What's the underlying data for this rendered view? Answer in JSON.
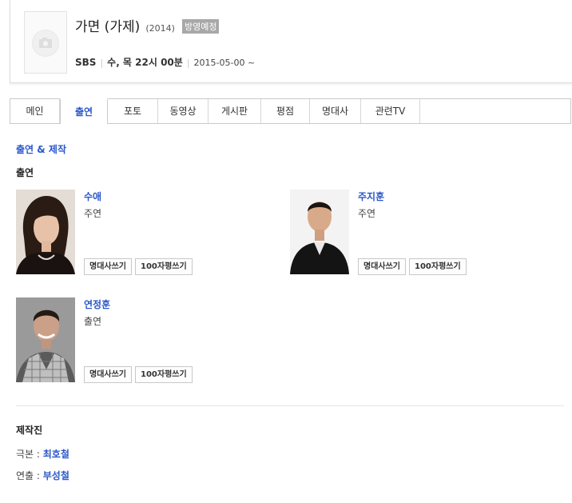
{
  "header": {
    "title": "가면 (가제)",
    "year": "(2014)",
    "badge": "방영예정",
    "channel": "SBS",
    "schedule": "수, 목 22시 00분",
    "date": "2015-05-00 ~"
  },
  "tabs": [
    {
      "label": "메인"
    },
    {
      "label": "출연",
      "active": true
    },
    {
      "label": "포토"
    },
    {
      "label": "동영상"
    },
    {
      "label": "게시판"
    },
    {
      "label": "평점"
    },
    {
      "label": "명대사"
    },
    {
      "label": "관련TV"
    }
  ],
  "section_title": "출연 & 제작",
  "cast_title": "출연",
  "cast": [
    {
      "name": "수애",
      "role": "주연",
      "btn_quote": "명대사쓰기",
      "btn_review": "100자평쓰기"
    },
    {
      "name": "주지훈",
      "role": "주연",
      "btn_quote": "명대사쓰기",
      "btn_review": "100자평쓰기"
    },
    {
      "name": "연정훈",
      "role": "출연",
      "btn_quote": "명대사쓰기",
      "btn_review": "100자평쓰기"
    }
  ],
  "crew_title": "제작진",
  "crew": [
    {
      "label": "극본 : ",
      "name": "최호철"
    },
    {
      "label": "연출 : ",
      "name": "부성철"
    }
  ]
}
